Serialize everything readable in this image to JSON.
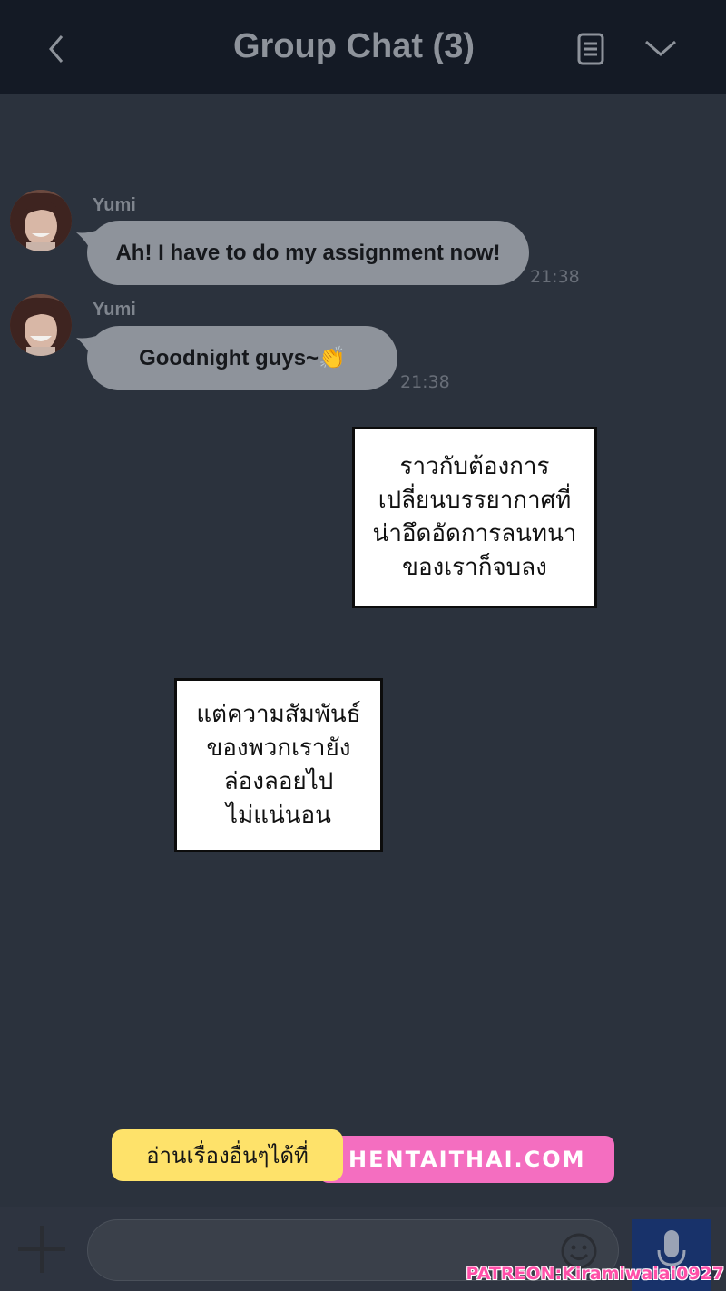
{
  "header": {
    "title": "Group Chat (3)",
    "back_icon": "chevron-left-icon",
    "notes_icon": "notes-icon",
    "menu_icon": "chevron-down-icon"
  },
  "messages": [
    {
      "sender": "Yumi",
      "text": "Ah! I have to do my assignment now!",
      "time": "21:38"
    },
    {
      "sender": "Yumi",
      "text": "Goodnight guys~👏",
      "time": "21:38"
    }
  ],
  "narration": [
    {
      "lines": [
        "ราวกับต้องการ",
        "เปลี่ยนบรรยากาศที่",
        "น่าอึดอัดการลนทนา",
        "ของเราก็จบลง"
      ]
    },
    {
      "lines": [
        "แต่ความสัมพันธ์",
        "ของพวกเรายัง",
        "ล่องลอยไป",
        "ไม่แน่นอน"
      ]
    }
  ],
  "promo": {
    "left_text": "อ่านเรื่องอื่นๆได้ที่",
    "right_text": "HENTAITHAI.COM"
  },
  "input_bar": {
    "placeholder": "",
    "plus_icon": "plus-icon",
    "emoji_icon": "emoji-icon",
    "mic_icon": "microphone-icon"
  },
  "watermark": "PATREON:Kiramiwaiai0927",
  "colors": {
    "background": "#2b323d",
    "header": "#141a25",
    "bubble": "#8e939b",
    "mic_button": "#18326a",
    "promo_pink": "#f46ec0",
    "promo_yellow": "#fee26a"
  }
}
